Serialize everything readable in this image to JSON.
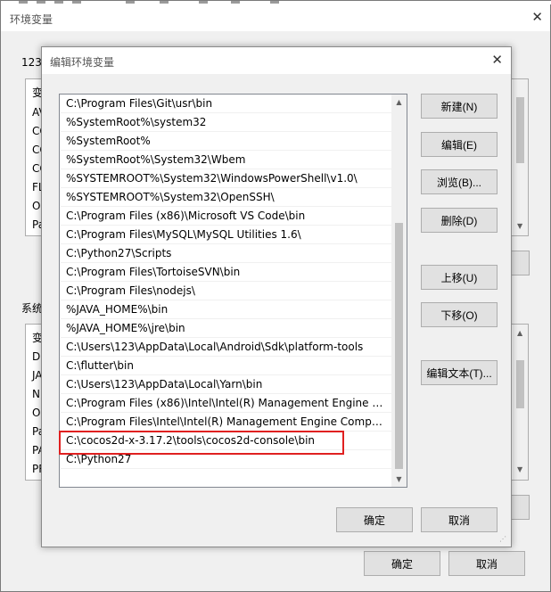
{
  "outer_dialog": {
    "title": "环境变量",
    "close_glyph": "✕",
    "user_group_label": "123",
    "system_group_label": "系统",
    "user_list_items": [
      "变",
      "AV",
      "CC",
      "CC",
      "CC",
      "FL",
      "Or",
      "Pa"
    ],
    "system_list_items": [
      "变",
      "Dr",
      "JA",
      "NU",
      "OS",
      "Pa",
      "PA",
      "PR"
    ],
    "ok_label": "确定",
    "cancel_label": "取消"
  },
  "edit_dialog": {
    "title": "编辑环境变量",
    "close_glyph": "✕",
    "paths": [
      "C:\\Program Files\\Git\\usr\\bin",
      "%SystemRoot%\\system32",
      "%SystemRoot%",
      "%SystemRoot%\\System32\\Wbem",
      "%SYSTEMROOT%\\System32\\WindowsPowerShell\\v1.0\\",
      "%SYSTEMROOT%\\System32\\OpenSSH\\",
      "C:\\Program Files (x86)\\Microsoft VS Code\\bin",
      "C:\\Program Files\\MySQL\\MySQL Utilities 1.6\\",
      "C:\\Python27\\Scripts",
      "C:\\Program Files\\TortoiseSVN\\bin",
      "C:\\Program Files\\nodejs\\",
      "%JAVA_HOME%\\bin",
      "%JAVA_HOME%\\jre\\bin",
      "C:\\Users\\123\\AppData\\Local\\Android\\Sdk\\platform-tools",
      "C:\\flutter\\bin",
      "C:\\Users\\123\\AppData\\Local\\Yarn\\bin",
      "C:\\Program Files (x86)\\Intel\\Intel(R) Management Engine Co...",
      "C:\\Program Files\\Intel\\Intel(R) Management Engine Compon...",
      "C:\\cocos2d-x-3.17.2\\tools\\cocos2d-console\\bin",
      "C:\\Python27"
    ],
    "buttons": {
      "new": "新建(N)",
      "edit": "编辑(E)",
      "browse": "浏览(B)...",
      "delete": "删除(D)",
      "move_up": "上移(U)",
      "move_down": "下移(O)",
      "edit_text": "编辑文本(T)..."
    },
    "ok_label": "确定",
    "cancel_label": "取消",
    "highlight_color": "#e02020"
  }
}
